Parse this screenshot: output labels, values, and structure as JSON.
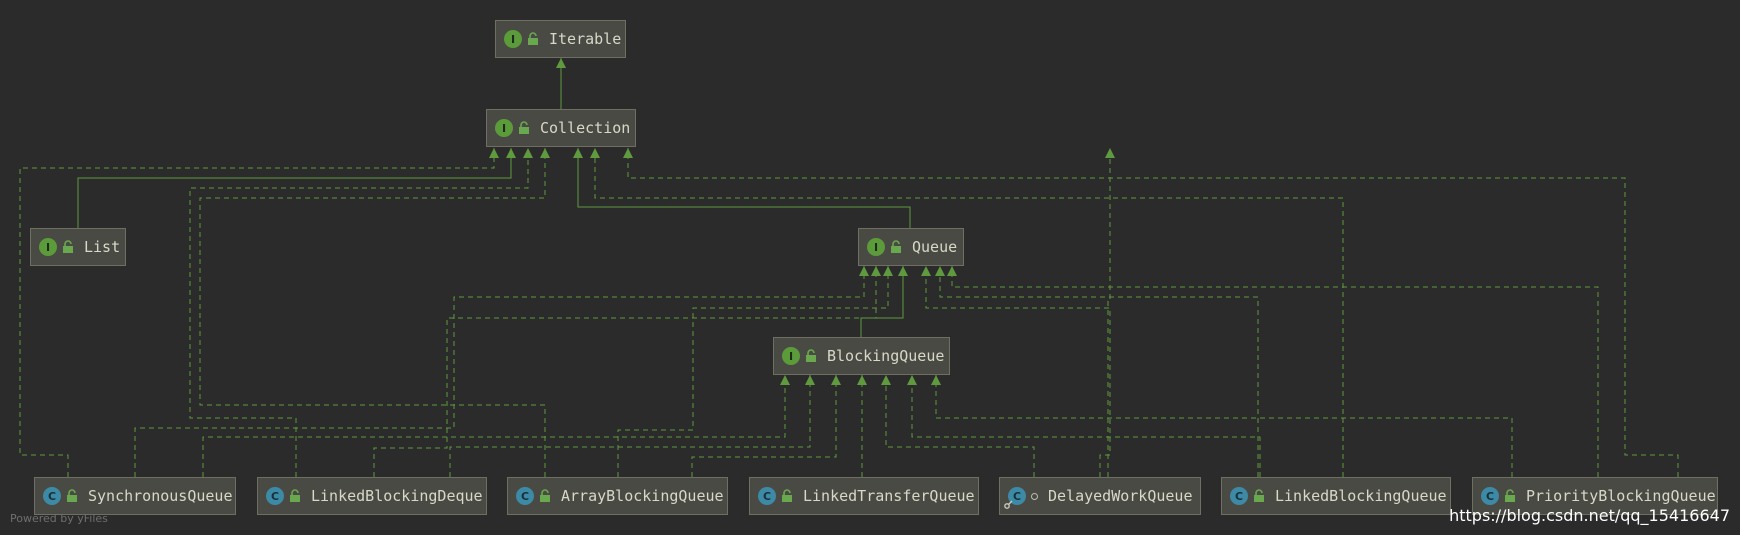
{
  "diagram": {
    "nodes": [
      {
        "id": "iterable",
        "label": "Iterable",
        "kind": "I",
        "icon": "interface-icon",
        "modifier": "public-lock-icon"
      },
      {
        "id": "collection",
        "label": "Collection",
        "kind": "I",
        "icon": "interface-icon",
        "modifier": "public-lock-icon"
      },
      {
        "id": "list",
        "label": "List",
        "kind": "I",
        "icon": "interface-icon",
        "modifier": "public-lock-icon"
      },
      {
        "id": "queue",
        "label": "Queue",
        "kind": "I",
        "icon": "interface-icon",
        "modifier": "public-lock-icon"
      },
      {
        "id": "blockingqueue",
        "label": "BlockingQueue",
        "kind": "I",
        "icon": "interface-icon",
        "modifier": "public-lock-icon"
      },
      {
        "id": "synchronousqueue",
        "label": "SynchronousQueue",
        "kind": "C",
        "icon": "class-icon",
        "modifier": "public-lock-icon"
      },
      {
        "id": "linkedblockingdeque",
        "label": "LinkedBlockingDeque",
        "kind": "C",
        "icon": "class-icon",
        "modifier": "public-lock-icon"
      },
      {
        "id": "arrayblockingqueue",
        "label": "ArrayBlockingQueue",
        "kind": "C",
        "icon": "class-icon",
        "modifier": "public-lock-icon"
      },
      {
        "id": "linkedtransferqueue",
        "label": "LinkedTransferQueue",
        "kind": "C",
        "icon": "class-icon",
        "modifier": "public-lock-icon"
      },
      {
        "id": "delayedworkqueue",
        "label": "DelayedWorkQueue",
        "kind": "C",
        "icon": "class-icon",
        "modifier": "package-private-dot-icon"
      },
      {
        "id": "linkedblockingqueue",
        "label": "LinkedBlockingQueue",
        "kind": "C",
        "icon": "class-icon",
        "modifier": "public-lock-icon"
      },
      {
        "id": "priorityblockingqueue",
        "label": "PriorityBlockingQueue",
        "kind": "C",
        "icon": "class-icon",
        "modifier": "public-lock-icon"
      }
    ],
    "edges": [
      {
        "from": "collection",
        "to": "iterable",
        "style": "extends"
      },
      {
        "from": "list",
        "to": "collection",
        "style": "extends"
      },
      {
        "from": "queue",
        "to": "collection",
        "style": "extends"
      },
      {
        "from": "blockingqueue",
        "to": "queue",
        "style": "extends"
      },
      {
        "from": "synchronousqueue",
        "to": "collection",
        "style": "implements"
      },
      {
        "from": "linkedblockingdeque",
        "to": "collection",
        "style": "implements"
      },
      {
        "from": "arrayblockingqueue",
        "to": "collection",
        "style": "implements"
      },
      {
        "from": "delayedworkqueue",
        "to": "collection",
        "style": "implements"
      },
      {
        "from": "linkedblockingqueue",
        "to": "collection",
        "style": "implements"
      },
      {
        "from": "priorityblockingqueue",
        "to": "collection",
        "style": "implements"
      },
      {
        "from": "synchronousqueue",
        "to": "queue",
        "style": "implements"
      },
      {
        "from": "linkedblockingdeque",
        "to": "queue",
        "style": "implements"
      },
      {
        "from": "arrayblockingqueue",
        "to": "queue",
        "style": "implements"
      },
      {
        "from": "delayedworkqueue",
        "to": "queue",
        "style": "implements"
      },
      {
        "from": "linkedblockingqueue",
        "to": "queue",
        "style": "implements"
      },
      {
        "from": "priorityblockingqueue",
        "to": "queue",
        "style": "implements"
      },
      {
        "from": "synchronousqueue",
        "to": "blockingqueue",
        "style": "implements"
      },
      {
        "from": "linkedblockingdeque",
        "to": "blockingqueue",
        "style": "implements"
      },
      {
        "from": "arrayblockingqueue",
        "to": "blockingqueue",
        "style": "implements"
      },
      {
        "from": "linkedtransferqueue",
        "to": "blockingqueue",
        "style": "implements"
      },
      {
        "from": "delayedworkqueue",
        "to": "blockingqueue",
        "style": "implements"
      },
      {
        "from": "linkedblockingqueue",
        "to": "blockingqueue",
        "style": "implements"
      },
      {
        "from": "priorityblockingqueue",
        "to": "blockingqueue",
        "style": "implements"
      }
    ]
  },
  "colors": {
    "background": "#2b2b2b",
    "edge": "#5f9a3f",
    "node_fill": "#4a4a44",
    "node_border": "#6e6e62",
    "node_text": "#d8d8c8",
    "interface_badge": "#5c9b3a",
    "class_badge": "#3d8aa6"
  },
  "footer": {
    "powered_by": "Powered by yFiles",
    "watermark": "https://blog.csdn.net/qq_15416647"
  }
}
